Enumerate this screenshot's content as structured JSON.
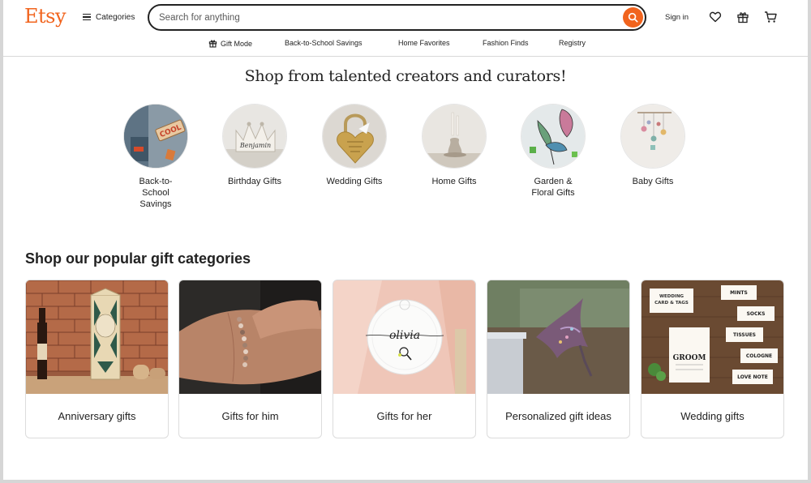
{
  "header": {
    "logo": "Etsy",
    "categories_label": "Categories",
    "search_placeholder": "Search for anything",
    "signin_label": "Sign in",
    "icons": [
      "heart-icon",
      "gift-icon",
      "cart-icon"
    ]
  },
  "subnav": [
    {
      "label": "Gift Mode",
      "icon": "gift-icon"
    },
    {
      "label": "Back-to-School Savings"
    },
    {
      "label": "Home Favorites"
    },
    {
      "label": "Fashion Finds"
    },
    {
      "label": "Registry"
    }
  ],
  "curators": {
    "headline": "Shop from talented creators and curators!",
    "items": [
      {
        "label": "Back-to-\nSchool\nSavings"
      },
      {
        "label": "Birthday Gifts"
      },
      {
        "label": "Wedding Gifts"
      },
      {
        "label": "Home Gifts"
      },
      {
        "label": "Garden &\nFloral Gifts"
      },
      {
        "label": "Baby Gifts"
      }
    ]
  },
  "popular": {
    "title": "Shop our popular gift categories",
    "cards": [
      {
        "label": "Anniversary gifts"
      },
      {
        "label": "Gifts for him"
      },
      {
        "label": "Gifts for her"
      },
      {
        "label": "Personalized gift ideas"
      },
      {
        "label": "Wedding gifts"
      }
    ]
  },
  "image_text": {
    "birthday_crown": "Benjamin",
    "school_sign": "COOL",
    "gifts_for_her": "olivia",
    "wedding_card_title": "WEDDING CARD & TAGS",
    "wedding_tags": [
      "MINTS",
      "SOCKS",
      "TISSUES",
      "COLOGNE",
      "LOVE NOTE"
    ],
    "wedding_card_main": "GROOM"
  },
  "colors": {
    "accent": "#f1641e",
    "text": "#222222",
    "border": "#dcdcdc"
  }
}
